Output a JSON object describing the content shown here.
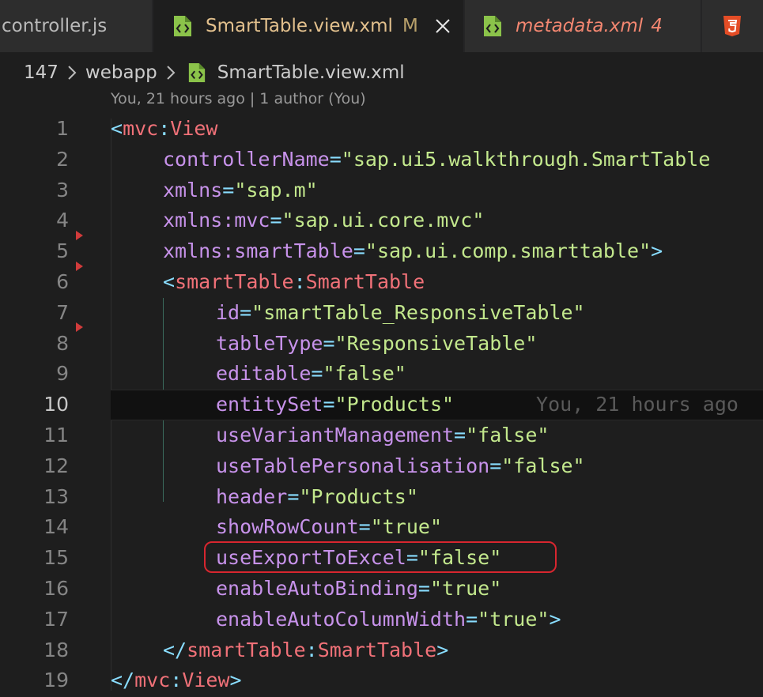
{
  "tabs": [
    {
      "label": "controller.js"
    },
    {
      "label": "SmartTable.view.xml",
      "badge": "M"
    },
    {
      "label": "metadata.xml",
      "badge": "4"
    },
    {
      "icon": "html5-icon"
    }
  ],
  "breadcrumb": {
    "items": [
      "147",
      "webapp",
      "SmartTable.view.xml"
    ]
  },
  "codelens": "You, 21 hours ago | 1 author (You)",
  "blame": "You, 21 hours ago",
  "current_line": 10,
  "highlighted_line": 15,
  "lines": [
    {
      "n": "1",
      "p": [
        "<",
        "mvc",
        ":",
        "View"
      ]
    },
    {
      "n": "2",
      "a": "controllerName",
      "v": "\"sap.ui5.walkthrough.SmartTable"
    },
    {
      "n": "3",
      "a": "xmlns",
      "v": "\"sap.m\""
    },
    {
      "n": "4",
      "a": "xmlns:mvc",
      "v": "\"sap.ui.core.mvc\""
    },
    {
      "n": "5",
      "a": "xmlns:smartTable",
      "v": "\"sap.ui.comp.smarttable\"",
      "end": ">"
    },
    {
      "n": "6",
      "p": [
        "<",
        "smartTable",
        ":",
        "SmartTable"
      ]
    },
    {
      "n": "7",
      "a": "id",
      "v": "\"smartTable_ResponsiveTable\""
    },
    {
      "n": "8",
      "a": "tableType",
      "v": "\"ResponsiveTable\""
    },
    {
      "n": "9",
      "a": "editable",
      "v": "\"false\""
    },
    {
      "n": "10",
      "a": "entitySet",
      "v": "\"Products\""
    },
    {
      "n": "11",
      "a": "useVariantManagement",
      "v": "\"false\""
    },
    {
      "n": "12",
      "a": "useTablePersonalisation",
      "v": "\"false\""
    },
    {
      "n": "13",
      "a": "header",
      "v": "\"Products\""
    },
    {
      "n": "14",
      "a": "showRowCount",
      "v": "\"true\""
    },
    {
      "n": "15",
      "a": "useExportToExcel",
      "v": "\"false\""
    },
    {
      "n": "16",
      "a": "enableAutoBinding",
      "v": "\"true\""
    },
    {
      "n": "17",
      "a": "enableAutoColumnWidth",
      "v": "\"true\"",
      "end": ">"
    },
    {
      "n": "18",
      "p": [
        "</",
        "smartTable",
        ":",
        "SmartTable",
        ">"
      ]
    },
    {
      "n": "19",
      "p": [
        "</",
        "mvc",
        ":",
        "View",
        ">"
      ]
    }
  ],
  "colors": {
    "modified": "#e2c08d",
    "error": "#f48771",
    "highlight": "#d7262f"
  }
}
